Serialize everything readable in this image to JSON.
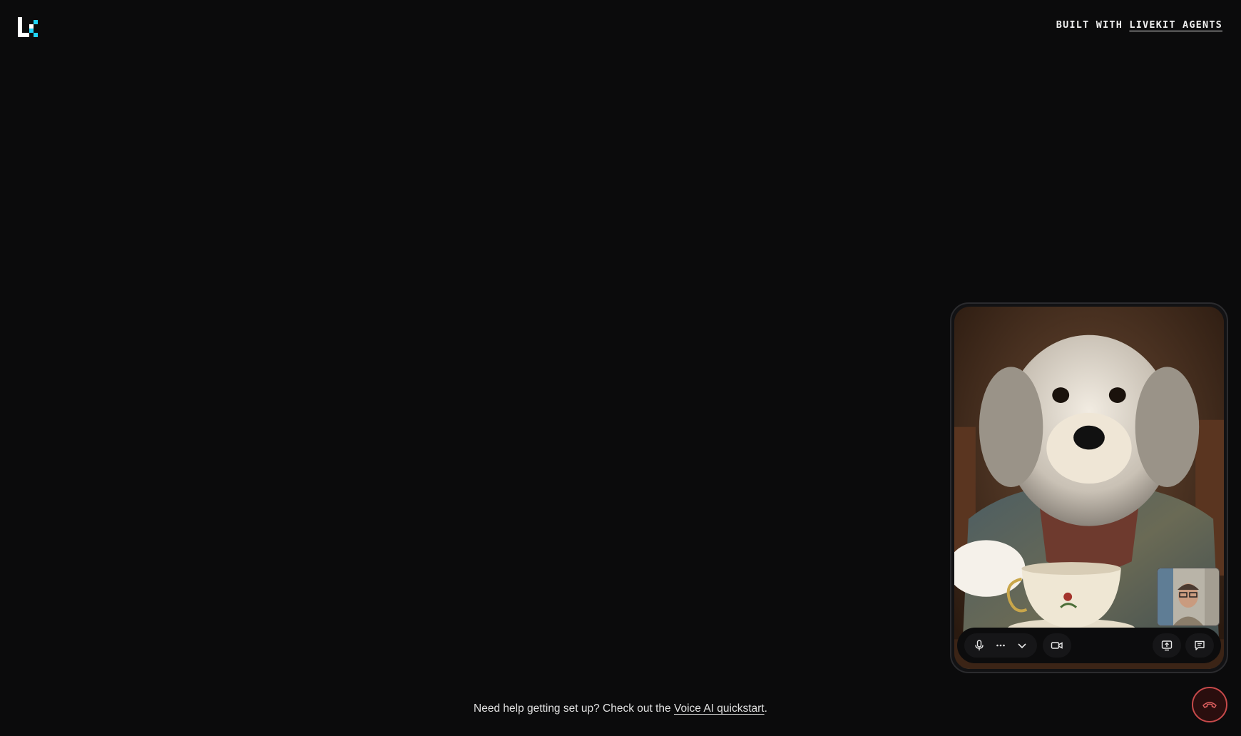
{
  "header": {
    "logo_icon": "livekit-logo-icon",
    "built_prefix": "BUILT WITH",
    "built_link": "LIVEKIT AGENTS"
  },
  "video": {
    "agent_feed": "dog-video-feed",
    "self_view": "user-camera-preview"
  },
  "controls": {
    "mic_icon": "microphone-icon",
    "more_icon": "ellipsis-icon",
    "dropdown_icon": "chevron-down-icon",
    "camera_icon": "video-camera-icon",
    "screen_share_icon": "screen-share-icon",
    "chat_icon": "chat-icon",
    "hangup_icon": "hang-up-icon"
  },
  "footer": {
    "help_prefix": "Need help getting set up? Check out the ",
    "help_link": "Voice AI quickstart",
    "help_suffix": "."
  },
  "colors": {
    "background": "#0b0b0c",
    "logo_accent": "#1fd5f9",
    "hangup_border": "#c6494a"
  }
}
